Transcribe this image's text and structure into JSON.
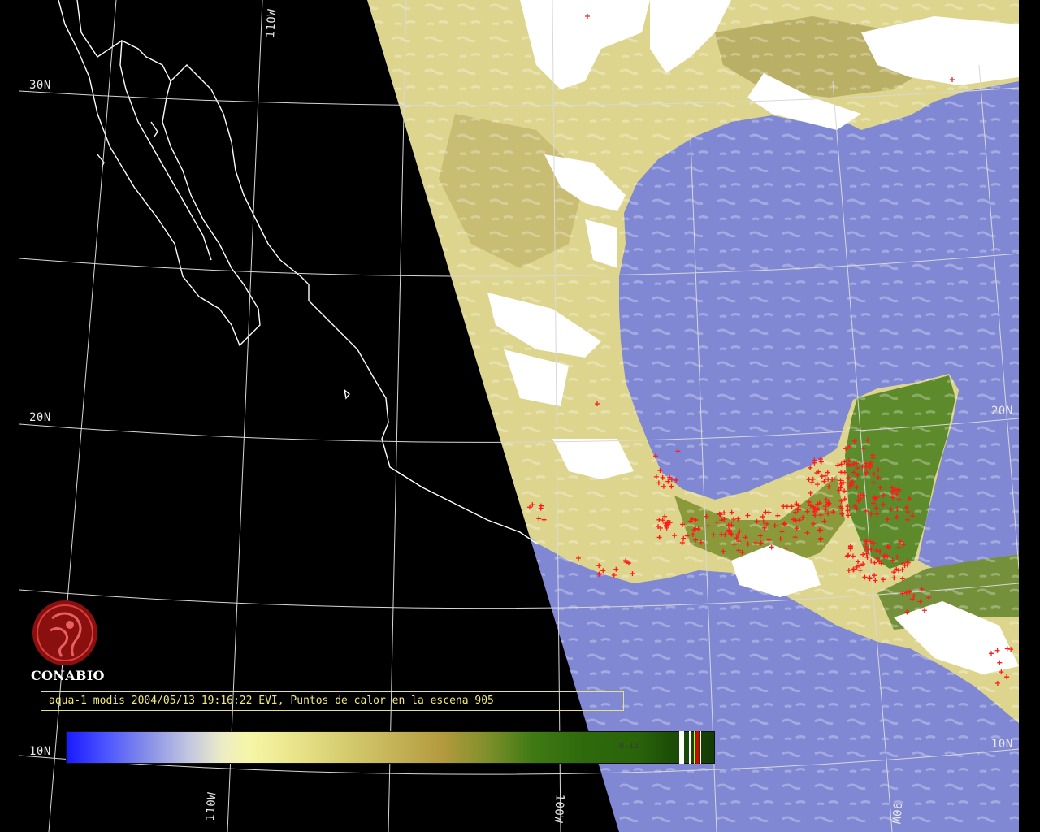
{
  "grid_labels": {
    "lat_30n_left": "30N",
    "lat_20n_left": "20N",
    "lat_10n_left": "10N",
    "lat_20n_right": "20N",
    "lat_10n_right": "10N",
    "lon_110w_top": "110W",
    "lon_110w_bottom": "110W",
    "lon_100w_bottom": "100W",
    "lon_90w_bottom": "90W"
  },
  "logo": {
    "name": "CONABIO"
  },
  "caption": "aqua-1 modis 2004/05/13 19:16:22 EVI, Puntos de calor en la escena 905",
  "colorbar": {
    "value_label": "0.12"
  },
  "colors": {
    "ocean": "#8088d4",
    "land_dry": "#e4df9a",
    "land_veg": "#4d7f1e",
    "cloud": "#ffffff",
    "night": "#000000",
    "fire_point": "#ff1a1a",
    "caption_text": "#f2ea7a"
  }
}
